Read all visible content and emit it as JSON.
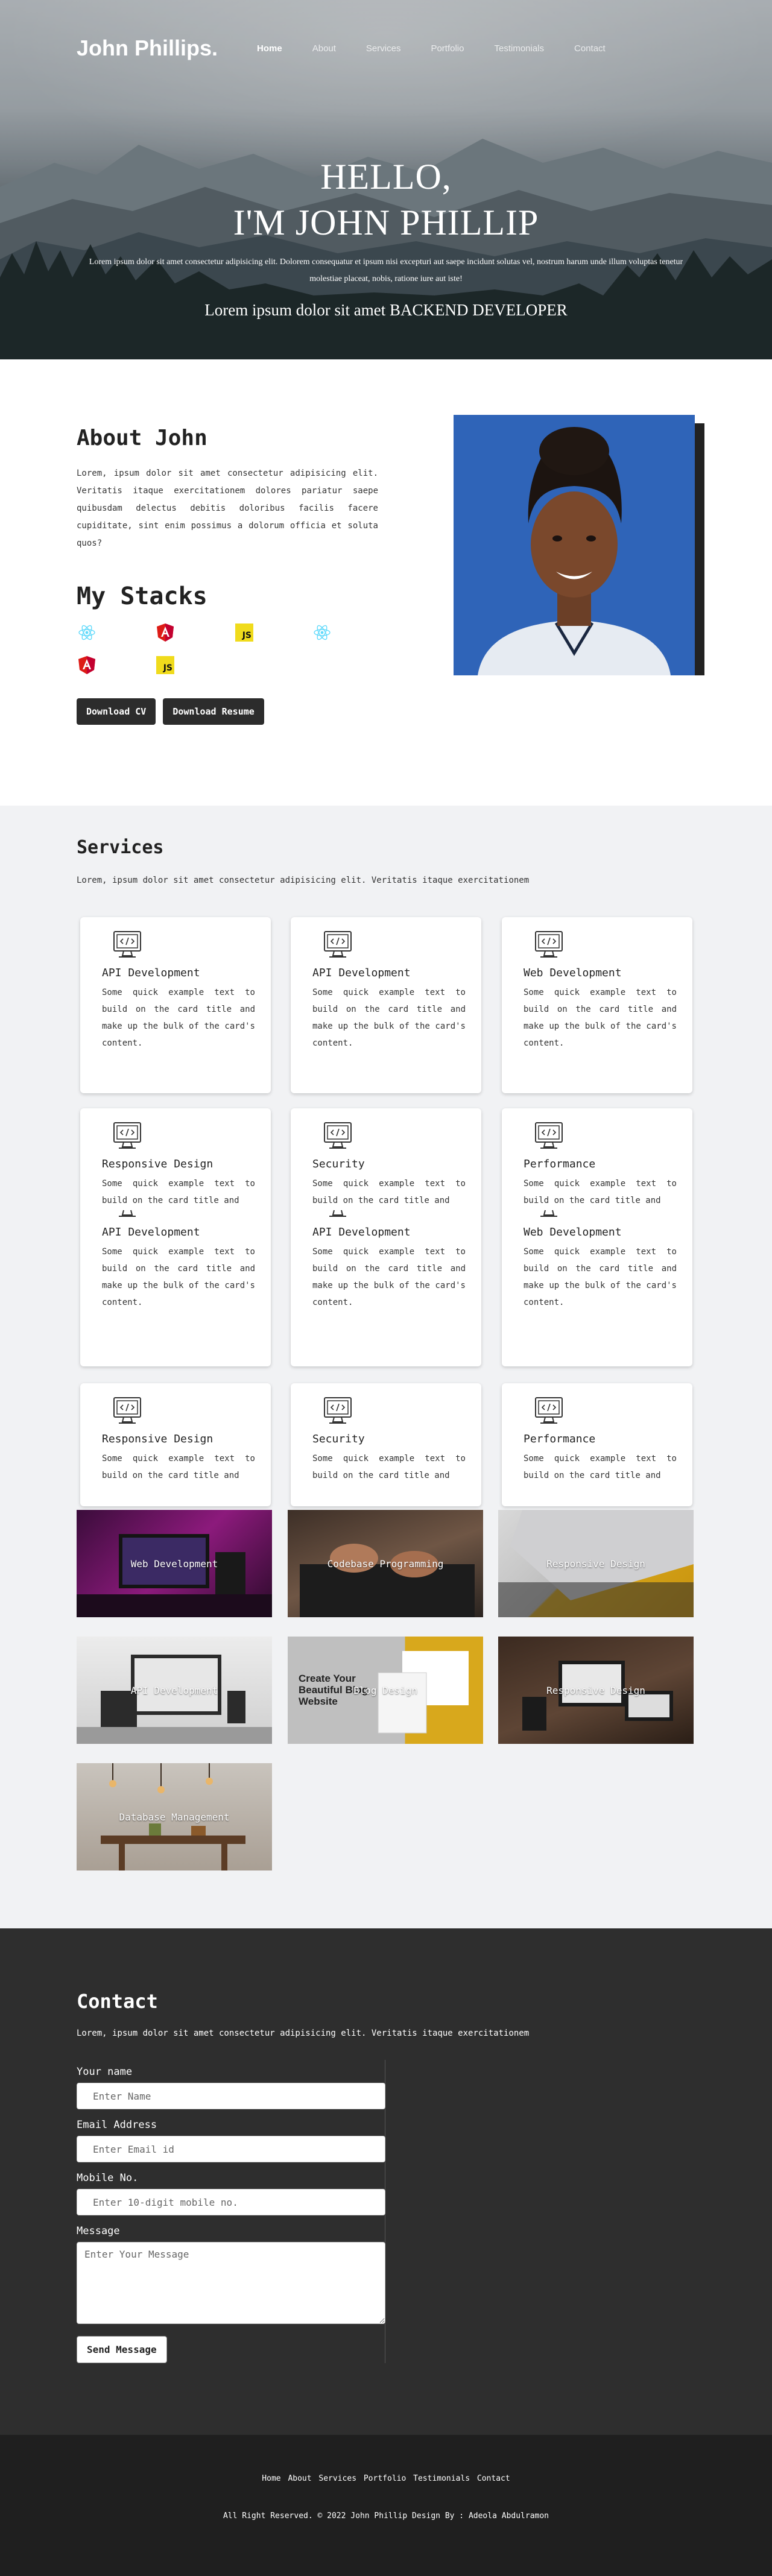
{
  "nav": {
    "brand": "John Phillips.",
    "links": [
      "Home",
      "About",
      "Services",
      "Portfolio",
      "Testimonials",
      "Contact"
    ]
  },
  "hero": {
    "heading_line1": "HELLO,",
    "heading_line2": "I'M JOHN PHILLIP",
    "subtext": "Lorem ipsum dolor sit amet consectetur adipisicing elit. Dolorem consequatur et ipsum nisi excepturi aut saepe incidunt solutas vel, nostrum harum unde illum voluptas tenetur molestiae placeat, nobis, ratione iure aut iste!",
    "role": "Lorem ipsum dolor sit amet BACKEND DEVELOPER"
  },
  "about": {
    "title": "About John",
    "text": "Lorem, ipsum dolor sit amet consectetur adipisicing elit. Veritatis itaque exercitationem dolores pariatur saepe quibusdam delectus debitis doloribus facilis facere cupiditate, sint enim possimus a dolorum officia et soluta quos?",
    "stacks_title": "My Stacks",
    "stacks": [
      "react-icon",
      "angular-icon",
      "javascript-icon",
      "react-icon",
      "angular-icon",
      "javascript-icon"
    ],
    "js_label": "JS",
    "download_cv": "Download CV",
    "download_resume": "Download Resume"
  },
  "services": {
    "title": "Services",
    "description": "Lorem, ipsum dolor sit amet consectetur adipisicing elit. Veritatis itaque exercitationem",
    "card_text_full": "Some quick example text to build on the card title and make up the bulk of the card's content.",
    "card_text_clipped": "Some quick example text to build on the card title and",
    "row1": [
      "API Development",
      "API Development",
      "Web Development"
    ],
    "row2": [
      "Responsive Design",
      "Security",
      "Performance"
    ],
    "row3": [
      "API Development",
      "API Development",
      "Web Development"
    ],
    "row4": [
      "Responsive Design",
      "Security",
      "Performance"
    ]
  },
  "portfolio": {
    "items": [
      "Web Development",
      "Codebase Programming",
      "Responsive Design",
      "API Development",
      "Blog Design",
      "Responsive Design",
      "Database Management"
    ],
    "blog_card_text": "Create Your Beautiful Blog Website"
  },
  "contact": {
    "title": "Contact",
    "description": "Lorem, ipsum dolor sit amet consectetur adipisicing elit. Veritatis itaque exercitationem",
    "name_label": "Your name",
    "name_placeholder": "Enter Name",
    "email_label": "Email Address",
    "email_placeholder": "Enter Email id",
    "mobile_label": "Mobile No.",
    "mobile_placeholder": "Enter 10-digit mobile no.",
    "message_label": "Message",
    "message_placeholder": "Enter Your Message",
    "send_label": "Send Message"
  },
  "footer": {
    "links": [
      "Home",
      "About",
      "Services",
      "Portfolio",
      "Testimonials",
      "Contact"
    ],
    "copyright": "All Right Reserved. © 2022 John Phillip Design By : Adeola Abdulramon"
  },
  "colors": {
    "accent_blue": "#2f64b8",
    "dark_button": "#2c2c2c",
    "contact_bg": "#2e2e2e",
    "footer_bg": "#1f1f1f",
    "js_yellow": "#f0db1c",
    "angular_red": "#dd1b16",
    "react_cyan": "#61dafb"
  }
}
